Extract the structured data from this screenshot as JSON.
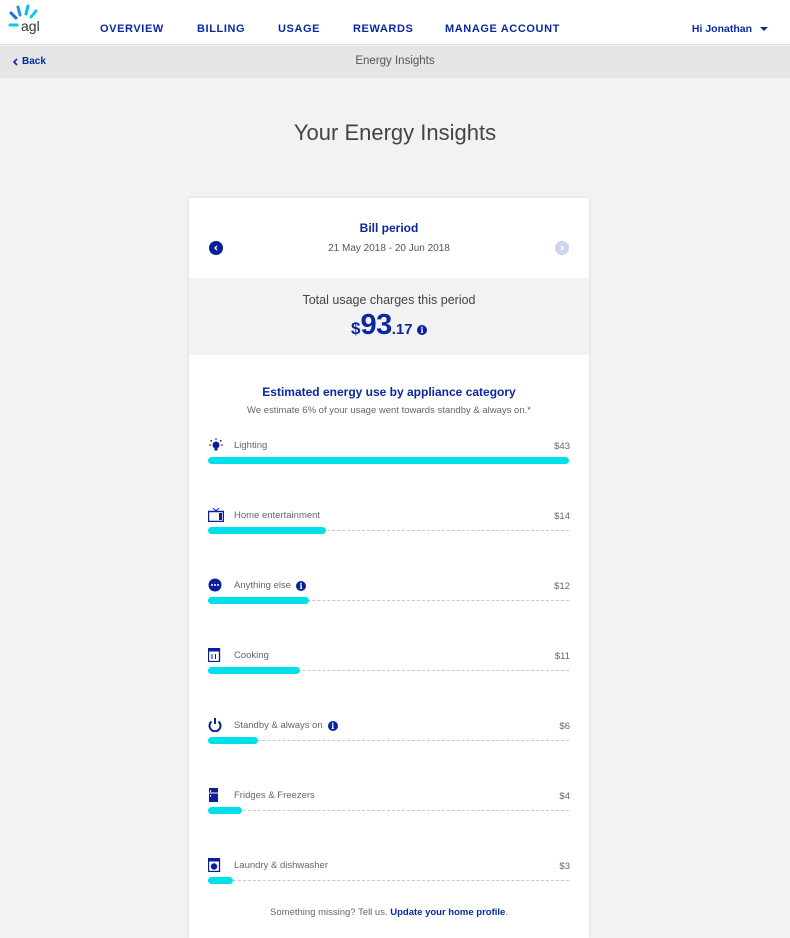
{
  "brand": {
    "logo_text": "agl",
    "primary_color": "#0a28a0",
    "accent_color": "#00e0ea"
  },
  "nav": {
    "items": [
      {
        "label": "OVERVIEW"
      },
      {
        "label": "BILLING"
      },
      {
        "label": "USAGE"
      },
      {
        "label": "REWARDS"
      },
      {
        "label": "MANAGE ACCOUNT"
      }
    ],
    "user_greeting": "Hi Jonathan"
  },
  "subbar": {
    "back_label": "Back",
    "title": "Energy Insights"
  },
  "page_title": "Your Energy Insights",
  "bill": {
    "period_label": "Bill period",
    "dates": "21 May 2018 - 20 Jun 2018",
    "total_label": "Total usage charges this period",
    "total_currency": "$",
    "total_whole": "93",
    "total_cents": ".17",
    "info_glyph": "i"
  },
  "appliances": {
    "title": "Estimated energy use by appliance category",
    "subtitle": "We estimate 6% of your usage went towards standby & always on.*",
    "max_value": 43,
    "items": [
      {
        "label": "Lighting",
        "icon": "lightbulb-icon",
        "value": 43,
        "value_label": "$43",
        "info": false
      },
      {
        "label": "Home entertainment",
        "icon": "tv-icon",
        "value": 14,
        "value_label": "$14",
        "info": false
      },
      {
        "label": "Anything else",
        "icon": "more-dots-icon",
        "value": 12,
        "value_label": "$12",
        "info": true
      },
      {
        "label": "Cooking",
        "icon": "oven-icon",
        "value": 11,
        "value_label": "$11",
        "info": false
      },
      {
        "label": "Standby & always on",
        "icon": "power-icon",
        "value": 6,
        "value_label": "$6",
        "info": true
      },
      {
        "label": "Fridges & Freezers",
        "icon": "fridge-icon",
        "value": 4,
        "value_label": "$4",
        "info": false
      },
      {
        "label": "Laundry & dishwasher",
        "icon": "washing-machine-icon",
        "value": 3,
        "value_label": "$3",
        "info": false
      }
    ]
  },
  "footer": {
    "text": "Something missing? Tell us.",
    "link_label": "Update your home profile",
    "trailing": "."
  }
}
